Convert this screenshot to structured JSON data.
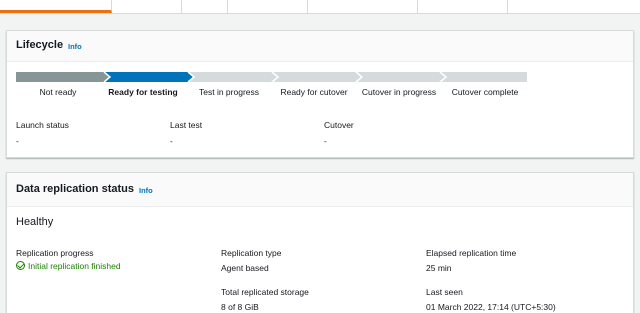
{
  "colors": {
    "accent": "#ec7211",
    "link": "#0073bb",
    "success": "#1d8102",
    "progress_done": "#879596",
    "progress_current": "#0073bb",
    "progress_todo": "#d5dbdb"
  },
  "lifecycle": {
    "title": "Lifecycle",
    "info": "Info",
    "steps": [
      {
        "label": "Not ready",
        "state": "done"
      },
      {
        "label": "Ready for testing",
        "state": "current"
      },
      {
        "label": "Test in progress",
        "state": "todo"
      },
      {
        "label": "Ready for cutover",
        "state": "todo"
      },
      {
        "label": "Cutover in progress",
        "state": "todo"
      },
      {
        "label": "Cutover complete",
        "state": "todo"
      }
    ],
    "launch_status": {
      "key": "Launch status",
      "value": "-"
    },
    "last_test": {
      "key": "Last test",
      "value": "-"
    },
    "cutover": {
      "key": "Cutover",
      "value": "-"
    }
  },
  "replication": {
    "title": "Data replication status",
    "info": "Info",
    "health": "Healthy",
    "progress": {
      "key": "Replication progress",
      "value": "Initial replication finished",
      "icon": "check-circle-icon"
    },
    "type": {
      "key": "Replication type",
      "value": "Agent based"
    },
    "elapsed": {
      "key": "Elapsed replication time",
      "value": "25 min"
    },
    "storage": {
      "key": "Total replicated storage",
      "value": "8 of 8 GiB"
    },
    "last_seen": {
      "key": "Last seen",
      "value": "01 March 2022, 17:14 (UTC+5:30)"
    }
  }
}
